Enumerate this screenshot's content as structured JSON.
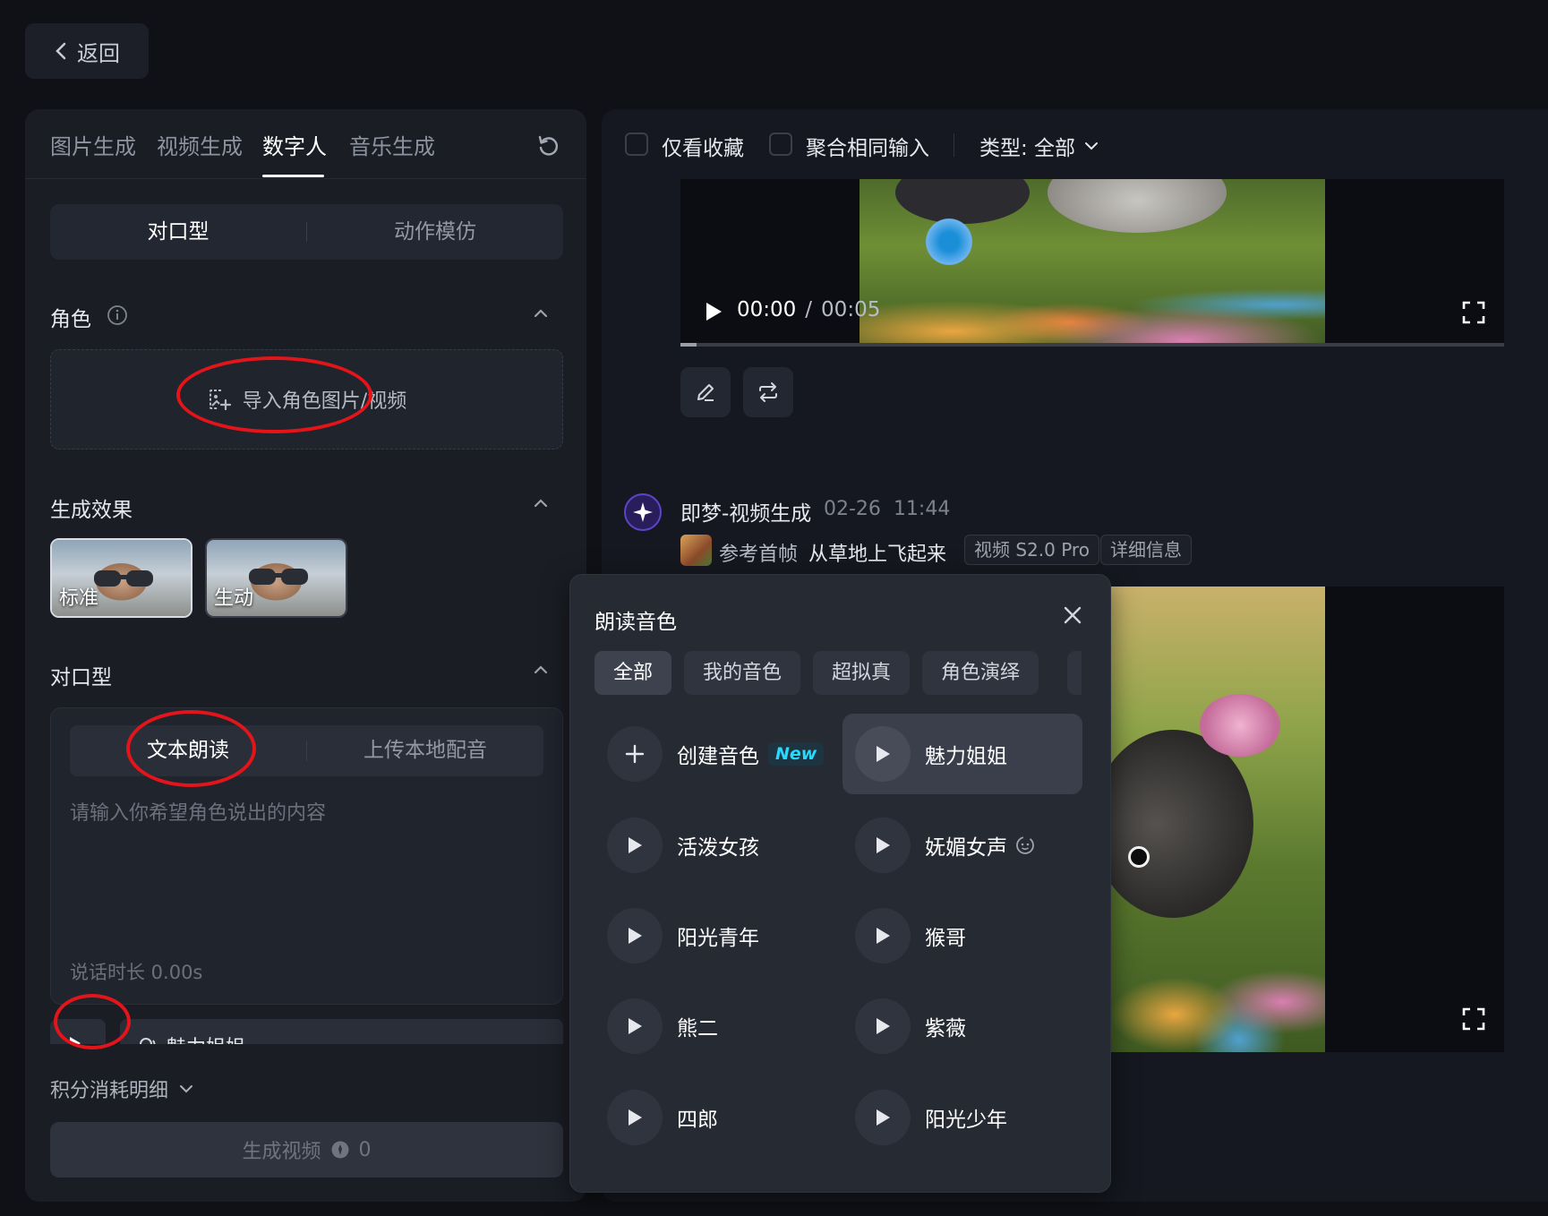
{
  "back": {
    "label": "返回"
  },
  "tabs": [
    {
      "label": "图片生成"
    },
    {
      "label": "视频生成"
    },
    {
      "label": "数字人"
    },
    {
      "label": "音乐生成"
    }
  ],
  "mode_seg": {
    "lip": "对口型",
    "motion": "动作模仿"
  },
  "role": {
    "title": "角色",
    "import_label": "导入角色图片/视频"
  },
  "effect": {
    "title": "生成效果",
    "cards": [
      {
        "label": "标准"
      },
      {
        "label": "生动"
      }
    ]
  },
  "lip": {
    "title": "对口型",
    "tab_text": "文本朗读",
    "tab_upload": "上传本地配音",
    "placeholder": "请输入你希望角色说出的内容",
    "duration": "说话时长 0.00s",
    "voice_name": "魅力姐姐"
  },
  "points": {
    "label": "积分消耗明细"
  },
  "generate": {
    "label": "生成视频",
    "cost": "0"
  },
  "filters": {
    "favorites": "仅看收藏",
    "merge": "聚合相同输入",
    "type": "类型: 全部"
  },
  "player": {
    "current": "00:00",
    "sep": "/",
    "total": "00:05",
    "progress": 0.02
  },
  "message": {
    "title": "即梦-视频生成",
    "date": "02-26",
    "time": "11:44",
    "ref_label": "参考首帧",
    "prompt": "从草地上飞起来",
    "model_badge": "视频 S2.0 Pro",
    "detail_badge": "详细信息"
  },
  "voice_popup": {
    "title": "朗读音色",
    "chips": [
      "全部",
      "我的音色",
      "超拟真",
      "角色演绎"
    ],
    "create_label": "创建音色",
    "new_badge": "New",
    "voices": [
      "魅力姐姐",
      "活泼女孩",
      "妩媚女声",
      "阳光青年",
      "猴哥",
      "熊二",
      "紫薇",
      "四郎",
      "阳光少年"
    ]
  },
  "colors": {
    "annotation": "#e3141a",
    "new_badge": "#27d8ff",
    "brand": "#5b45c8"
  }
}
